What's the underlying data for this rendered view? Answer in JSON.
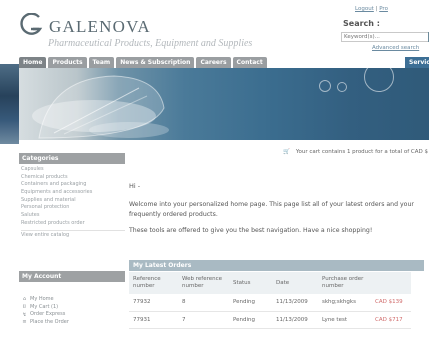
{
  "header": {
    "brand": "GALENOVA",
    "tagline": "Pharmaceutical Products, Equipment and Supplies",
    "logout": "Logout",
    "toplink2": "Pro",
    "search_label": "Search :",
    "search_placeholder": "Keyword(s)...",
    "advanced_search": "Advanced search"
  },
  "nav": {
    "tabs": [
      "Home",
      "Products",
      "Team",
      "News & Subscription",
      "Careers",
      "Contact"
    ],
    "services": "Servic"
  },
  "sidebar": {
    "categories_title": "Categories",
    "categories": [
      "Capsules",
      "Chemical products",
      "Containers and packaging",
      "Equipments and accessories",
      "Supplies and material",
      "Personal protection",
      "Salutes",
      "Restricted products order"
    ],
    "view_catalog": "View entire catalog",
    "account_title": "My Account",
    "account_items": [
      {
        "icon": "home-icon",
        "label": "My Home"
      },
      {
        "icon": "cart-icon",
        "label": "My Cart (1)"
      },
      {
        "icon": "lightning-icon",
        "label": "Order Express"
      },
      {
        "icon": "list-icon",
        "label": "Place the Order"
      }
    ]
  },
  "main": {
    "cart_text": "Your cart contains 1 product for a total of CAD $",
    "greeting": "Hi -",
    "intro": "Welcome into your personalized home page. This page list all of your latest orders and your frequently ordered products.",
    "tools": "These tools are offered to give you the best navigation. Have a nice shopping!",
    "orders_title": "My Latest Orders",
    "columns": [
      "Reference number",
      "Web reference number",
      "Status",
      "Date",
      "Purchase order number",
      ""
    ],
    "rows": [
      [
        "77932",
        "8",
        "Pending",
        "11/13/2009",
        "skhg;skhgks",
        "CAD $139"
      ],
      [
        "77931",
        "7",
        "Pending",
        "11/13/2009",
        "Lyne test",
        "CAD $717"
      ]
    ]
  },
  "colors": {
    "accent": "#3d6f95",
    "tab": "#9a9ea1",
    "amount": "#d06a6a"
  }
}
